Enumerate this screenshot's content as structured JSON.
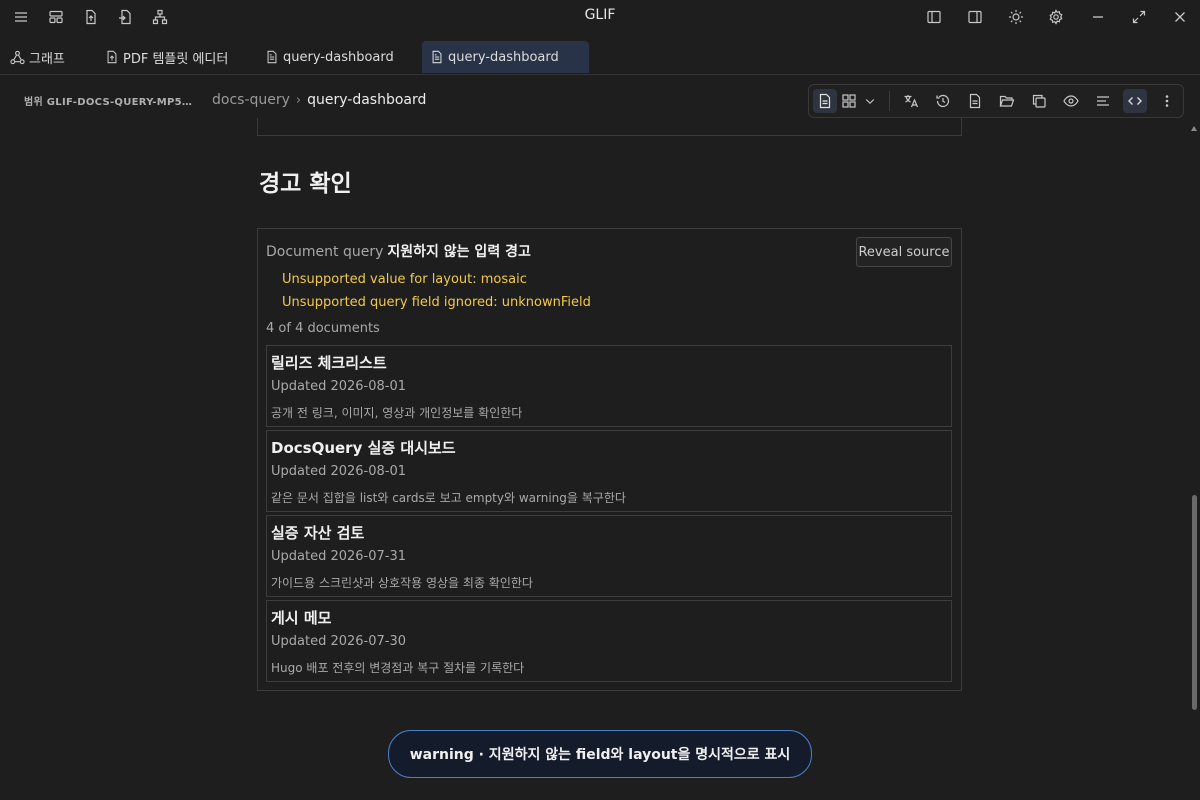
{
  "app": {
    "title": "GLIF"
  },
  "titlebar": {
    "left_icons": [
      "menu-icon",
      "layout-icon",
      "export-icon",
      "import-icon",
      "sitemap-icon"
    ],
    "right_icons": [
      "sidebar-left-icon",
      "sidebar-right-icon",
      "sun-icon",
      "gear-icon",
      "minimize-icon",
      "maximize-icon",
      "close-icon"
    ]
  },
  "tabs": [
    {
      "label": "그래프",
      "icon": "graph-icon",
      "active": false
    },
    {
      "label": "PDF 템플릿 에디터",
      "icon": "file-export-icon",
      "active": false
    },
    {
      "label": "query-dashboard",
      "icon": "document-icon",
      "active": false
    },
    {
      "label": "query-dashboard",
      "icon": "document-icon",
      "active": true
    }
  ],
  "breadcrumb": {
    "scope": "범위 GLIF-DOCS-QUERY-MP5O...",
    "folder": "docs-query",
    "separator": "›",
    "current": "query-dashboard"
  },
  "toolbar": {
    "tools": [
      "document-view-icon",
      "grid-view-icon",
      "chevron-down-icon",
      "translate-icon",
      "history-icon",
      "file-text-icon",
      "folder-open-icon",
      "copy-icon",
      "eye-icon",
      "align-left-icon",
      "code-icon",
      "more-vertical-icon"
    ],
    "active": "document-view-icon"
  },
  "content": {
    "section_heading": "경고 확인",
    "query": {
      "kind": "Document query",
      "title": "지원하지 않는 입력 경고",
      "reveal_label": "Reveal source",
      "warnings": [
        "Unsupported value for layout: mosaic",
        "Unsupported query field ignored: unknownField"
      ],
      "count": "4 of 4 documents",
      "documents": [
        {
          "title": "릴리즈 체크리스트",
          "date": "Updated 2026-08-01",
          "desc": "공개 전 링크, 이미지, 영상과 개인정보를 확인한다"
        },
        {
          "title": "DocsQuery 실증 대시보드",
          "date": "Updated 2026-08-01",
          "desc": "같은 문서 집합을 list와 cards로 보고 empty와 warning을 복구한다"
        },
        {
          "title": "실증 자산 검토",
          "date": "Updated 2026-07-31",
          "desc": "가이드용 스크린샷과 상호작용 영상을 최종 확인한다"
        },
        {
          "title": "게시 메모",
          "date": "Updated 2026-07-30",
          "desc": "Hugo 배포 전후의 변경점과 복구 절차를 기록한다"
        }
      ]
    }
  },
  "status_pill": {
    "text": "warning · 지원하지 않는 field와 layout을 명시적으로 표시"
  },
  "colors": {
    "background": "#1e1e1e",
    "warning": "#f2c94c",
    "accent": "#4a7fd0",
    "active_tab": "#283347"
  }
}
